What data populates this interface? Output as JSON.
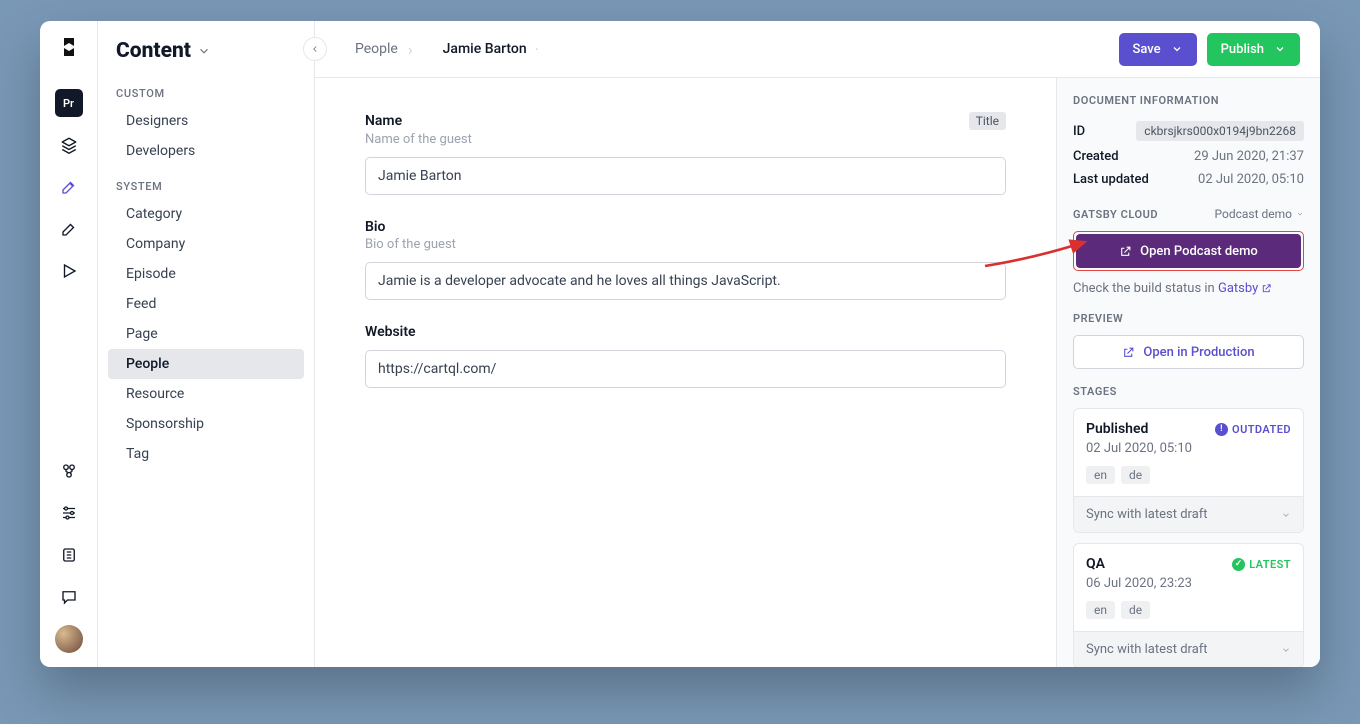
{
  "rail": {
    "project_badge": "Pr"
  },
  "sidebar": {
    "title": "Content",
    "sections": {
      "custom": {
        "label": "CUSTOM",
        "items": [
          "Designers",
          "Developers"
        ]
      },
      "system": {
        "label": "SYSTEM",
        "items": [
          "Category",
          "Company",
          "Episode",
          "Feed",
          "Page",
          "People",
          "Resource",
          "Sponsorship",
          "Tag"
        ],
        "active": "People"
      }
    }
  },
  "breadcrumb": {
    "root": "People",
    "current": "Jamie Barton"
  },
  "actions": {
    "save": "Save",
    "publish": "Publish"
  },
  "form": {
    "name": {
      "label": "Name",
      "badge": "Title",
      "hint": "Name of the guest",
      "value": "Jamie Barton"
    },
    "bio": {
      "label": "Bio",
      "hint": "Bio of the guest",
      "value": "Jamie is a developer advocate and he loves all things JavaScript."
    },
    "website": {
      "label": "Website",
      "value": "https://cartql.com/"
    }
  },
  "panel": {
    "docinfo": {
      "label": "DOCUMENT INFORMATION",
      "id_label": "ID",
      "id_value": "ckbrsjkrs000x0194j9bn2268",
      "created_label": "Created",
      "created_value": "29 Jun 2020, 21:37",
      "updated_label": "Last updated",
      "updated_value": "02 Jul 2020, 05:10"
    },
    "gatsby": {
      "label": "GATSBY CLOUD",
      "target": "Podcast demo",
      "open_btn": "Open Podcast demo",
      "hint_prefix": "Check the build status in ",
      "hint_link": "Gatsby"
    },
    "preview": {
      "label": "PREVIEW",
      "btn": "Open in Production"
    },
    "stages": {
      "label": "STAGES",
      "sync_label": "Sync with latest draft",
      "items": [
        {
          "title": "Published",
          "status": "OUTDATED",
          "status_kind": "outdated",
          "date": "02 Jul 2020, 05:10",
          "langs": [
            "en",
            "de"
          ]
        },
        {
          "title": "QA",
          "status": "LATEST",
          "status_kind": "latest",
          "date": "06 Jul 2020, 23:23",
          "langs": [
            "en",
            "de"
          ]
        }
      ]
    }
  }
}
